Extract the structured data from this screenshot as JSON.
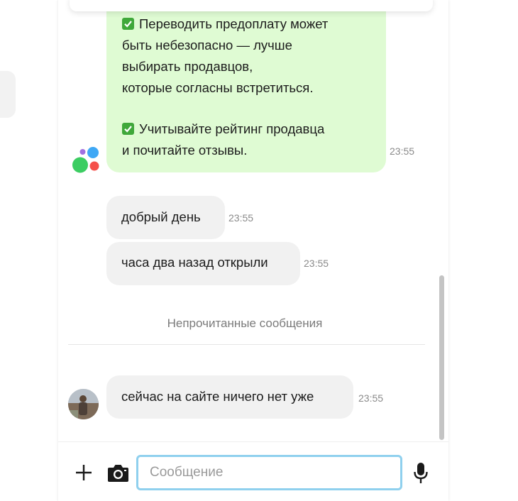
{
  "system_message": {
    "lines": [
      "Переводить предоплату может",
      "быть небезопасно — лучше",
      "выбирать продавцов,",
      "которые согласны встретиться.",
      "Учитывайте рейтинг продавца",
      "и почитайте отзывы."
    ],
    "time": "23:55",
    "check_icon": "check-mark-icon",
    "colors": {
      "bubble": "#dffbd3",
      "check": "#3fa83a"
    }
  },
  "messages": [
    {
      "text": "добрый день",
      "time": "23:55"
    },
    {
      "text": "часа два назад открыли",
      "time": "23:55"
    }
  ],
  "unread_divider": {
    "label": "Непрочитанные сообщения"
  },
  "last_message": {
    "text": "сейчас на сайте ничего нет уже",
    "time": "23:55"
  },
  "composer": {
    "placeholder": "Сообщение",
    "value": "",
    "accent": "#8fd0ee"
  },
  "logo_colors": [
    "#a070e0",
    "#3fa8f5",
    "#3ccd62",
    "#f5504a"
  ]
}
